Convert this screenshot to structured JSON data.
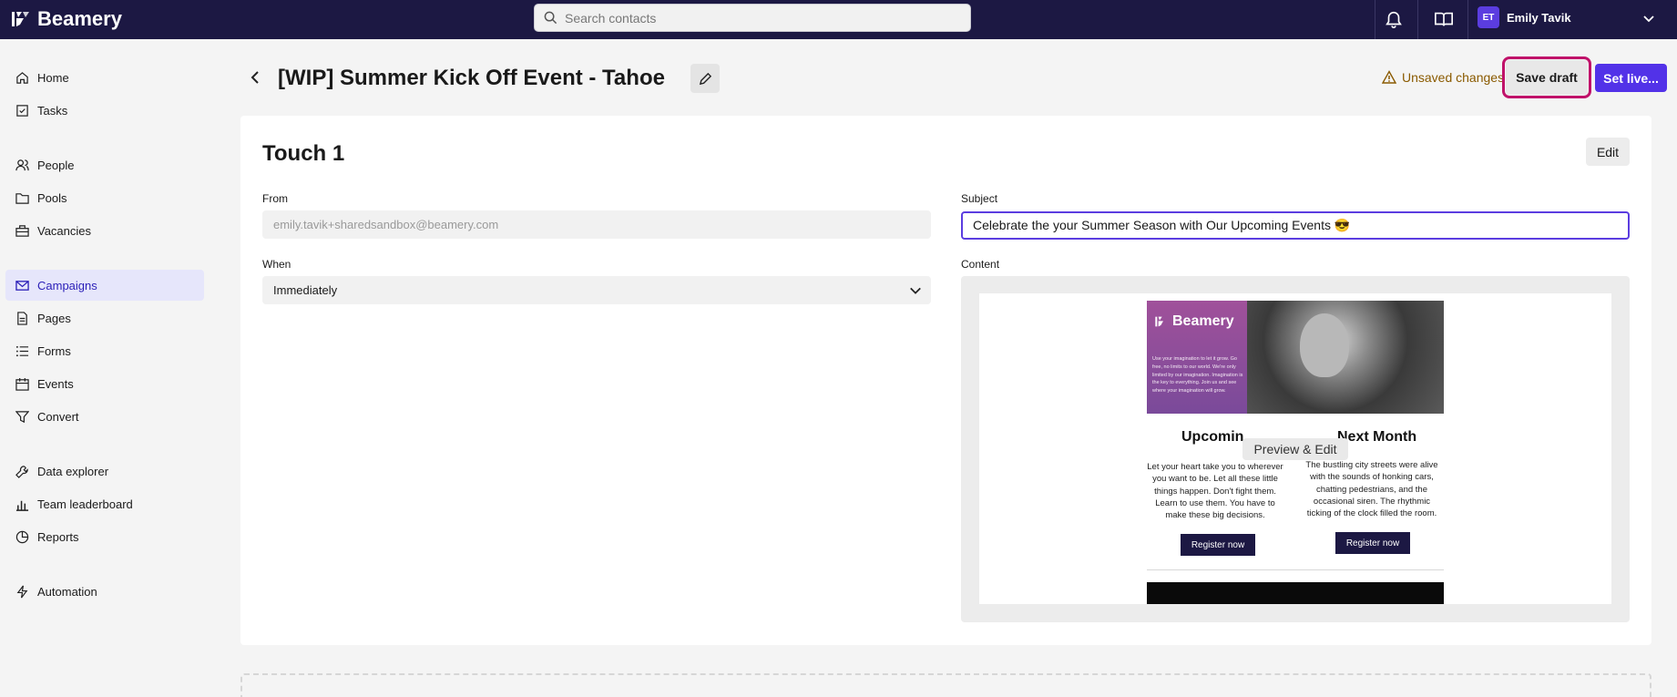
{
  "brand": {
    "name": "Beamery"
  },
  "search": {
    "placeholder": "Search contacts"
  },
  "user": {
    "initials": "ET",
    "name": "Emily Tavik"
  },
  "sidebar": {
    "items": [
      {
        "label": "Home",
        "icon": "home-icon"
      },
      {
        "label": "Tasks",
        "icon": "tasks-icon"
      },
      {
        "label": "People",
        "icon": "people-icon"
      },
      {
        "label": "Pools",
        "icon": "folder-icon"
      },
      {
        "label": "Vacancies",
        "icon": "briefcase-icon"
      },
      {
        "label": "Campaigns",
        "icon": "mail-icon",
        "active": true
      },
      {
        "label": "Pages",
        "icon": "page-icon"
      },
      {
        "label": "Forms",
        "icon": "list-icon"
      },
      {
        "label": "Events",
        "icon": "calendar-icon"
      },
      {
        "label": "Convert",
        "icon": "funnel-icon"
      },
      {
        "label": "Data explorer",
        "icon": "wrench-icon"
      },
      {
        "label": "Team leaderboard",
        "icon": "bar-chart-icon"
      },
      {
        "label": "Reports",
        "icon": "pie-chart-icon"
      },
      {
        "label": "Automation",
        "icon": "bolt-icon"
      }
    ]
  },
  "header": {
    "title": "[WIP] Summer Kick Off Event - Tahoe",
    "unsaved": "Unsaved changes",
    "save_draft": "Save draft",
    "set_live": "Set live..."
  },
  "touch": {
    "title": "Touch 1",
    "edit": "Edit",
    "from_label": "From",
    "from_value": "emily.tavik+sharedsandbox@beamery.com",
    "when_label": "When",
    "when_value": "Immediately",
    "subject_label": "Subject",
    "subject_value": "Celebrate the your Summer Season with Our Upcoming Events 😎",
    "content_label": "Content"
  },
  "email_preview": {
    "logo": "Beamery",
    "hero_text": "Use your imagination to let it grow. Go free, no limits to our world. We're only limited by our imagination. Imagination is the key to everything. Join us and see where your imagination will grow.",
    "left_title": "Upcomin",
    "left_text": "Let your heart take you to wherever you want to be. Let all these little things happen. Don't fight them. Learn to use them. You have to make these big decisions.",
    "left_button": "Register now",
    "right_title": "Next Month",
    "right_text": "The bustling city streets were alive with the sounds of honking cars, chatting pedestrians, and the occasional siren. The rhythmic ticking of the clock filled the room.",
    "right_button": "Register now",
    "overlay": "Preview & Edit"
  }
}
